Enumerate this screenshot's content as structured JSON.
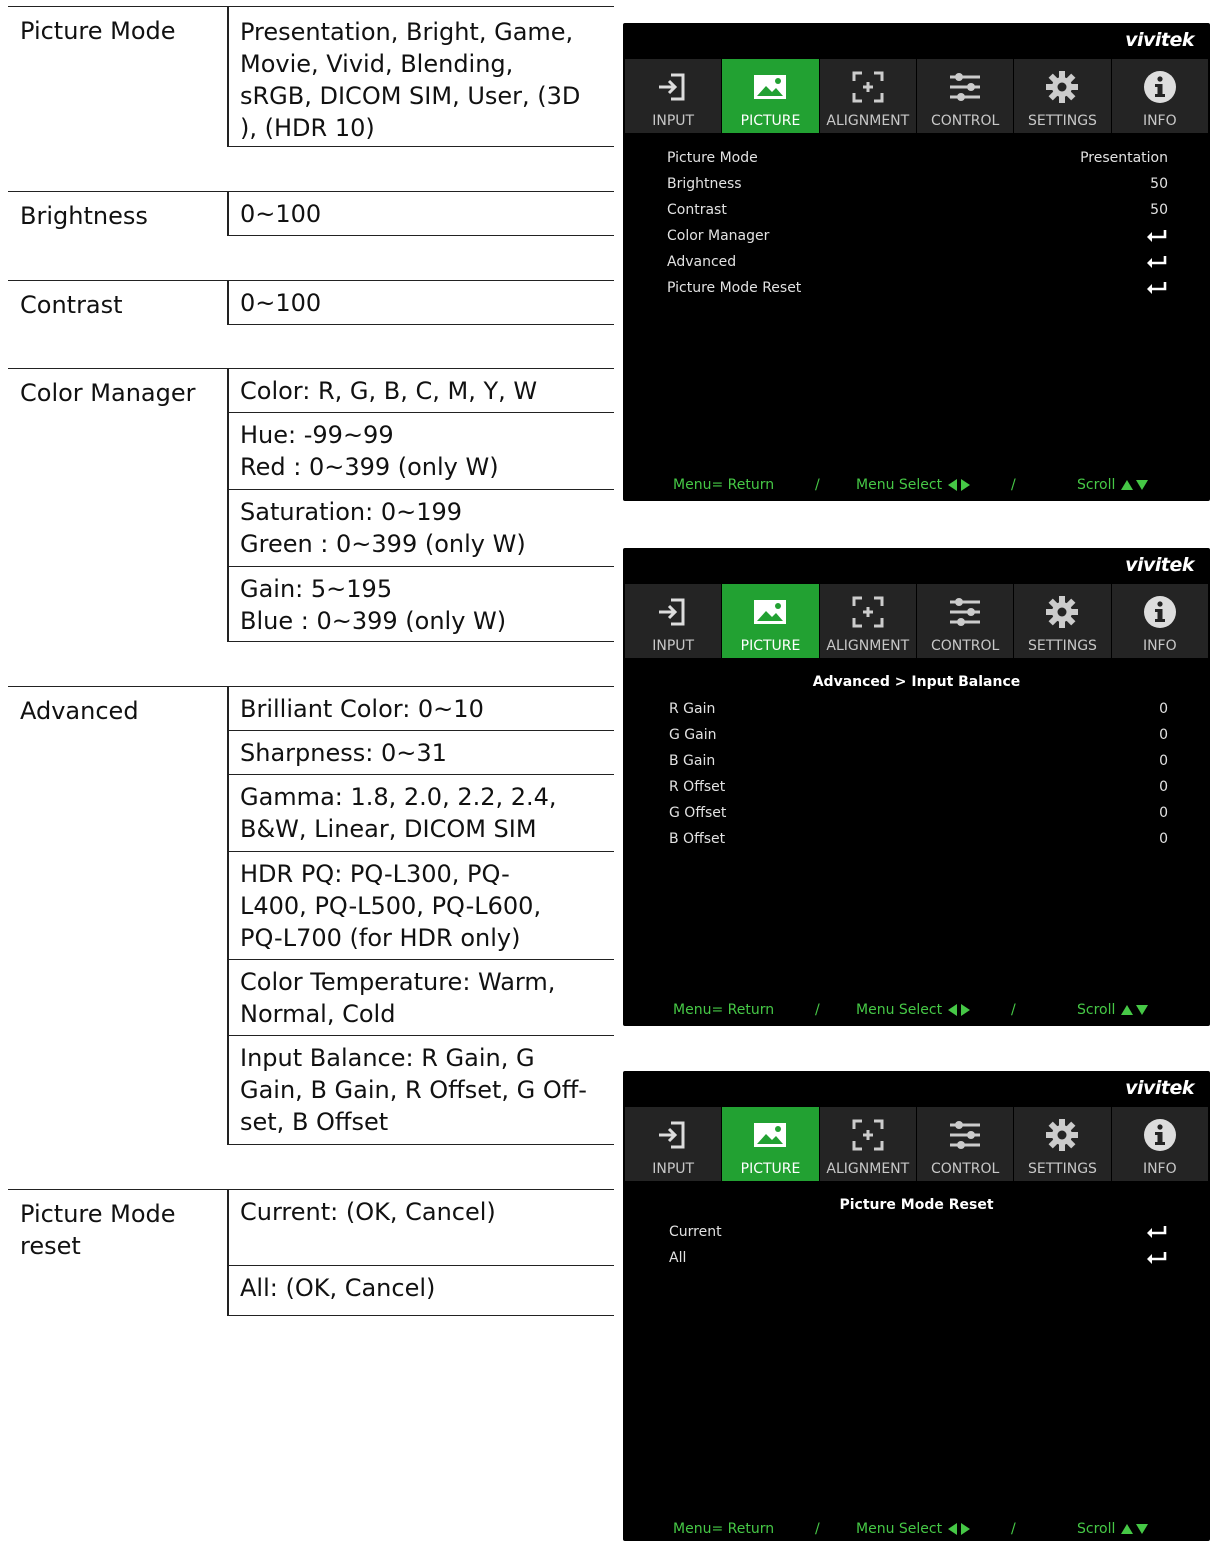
{
  "table": {
    "picture_mode": {
      "label": "Picture Mode",
      "lines": [
        "Presentation, Bright, Game,",
        "Movie, Vivid, Blending,",
        "sRGB, DICOM SIM, User, (3D",
        "), (HDR 10)"
      ]
    },
    "brightness": {
      "label": "Brightness",
      "value": "0~100"
    },
    "contrast": {
      "label": "Contrast",
      "value": "0~100"
    },
    "color_manager": {
      "label": "Color Manager",
      "cells": [
        [
          "Color: R, G, B, C, M, Y, W"
        ],
        [
          "Hue: -99~99",
          "Red : 0~399 (only W)"
        ],
        [
          "Saturation: 0~199",
          "Green : 0~399 (only W)"
        ],
        [
          "Gain: 5~195",
          "Blue : 0~399 (only W)"
        ]
      ]
    },
    "advanced": {
      "label": "Advanced",
      "cells": [
        [
          "Brilliant Color: 0~10"
        ],
        [
          "Sharpness: 0~31"
        ],
        [
          "Gamma: 1.8, 2.0, 2.2, 2.4,",
          "B&W, Linear, DICOM SIM"
        ],
        [
          "HDR PQ: PQ-L300, PQ-",
          "L400, PQ-L500, PQ-L600,",
          "PQ-L700 (for HDR only)"
        ],
        [
          "Color Temperature: Warm,",
          "Normal, Cold"
        ],
        [
          "Input Balance: R Gain, G",
          "Gain, B Gain, R Offset, G Off-",
          "set, B Offset"
        ]
      ]
    },
    "picture_mode_reset": {
      "label_lines": [
        "Picture Mode",
        "reset"
      ],
      "cells": [
        [
          "Current: (OK, Cancel)"
        ],
        [
          "All: (OK, Cancel)"
        ]
      ]
    }
  },
  "osd": {
    "brand": "vivitek",
    "tabs": [
      "INPUT",
      "PICTURE",
      "ALIGNMENT",
      "CONTROL",
      "SETTINGS",
      "INFO"
    ],
    "active_tab": "PICTURE",
    "footer": {
      "return": "Menu= Return",
      "sep": "/",
      "select": "Menu Select",
      "scroll": "Scroll"
    },
    "accent_color": "#22a132",
    "footer_color": "#46c846",
    "screen1": {
      "rows": [
        {
          "label": "Picture Mode",
          "value": "Presentation"
        },
        {
          "label": "Brightness",
          "value": "50"
        },
        {
          "label": "Contrast",
          "value": "50"
        },
        {
          "label": "Color Manager",
          "icon": "enter-icon"
        },
        {
          "label": "Advanced",
          "icon": "enter-icon"
        },
        {
          "label": "Picture Mode Reset",
          "icon": "enter-icon"
        }
      ]
    },
    "screen2": {
      "title": "Advanced > Input Balance",
      "rows": [
        {
          "label": "R Gain",
          "value": "0"
        },
        {
          "label": "G Gain",
          "value": "0"
        },
        {
          "label": "B Gain",
          "value": "0"
        },
        {
          "label": "R Offset",
          "value": "0"
        },
        {
          "label": "G Offset",
          "value": "0"
        },
        {
          "label": "B Offset",
          "value": "0"
        }
      ]
    },
    "screen3": {
      "title": "Picture Mode Reset",
      "rows": [
        {
          "label": "Current",
          "icon": "enter-icon"
        },
        {
          "label": "All",
          "icon": "enter-icon"
        }
      ]
    }
  }
}
